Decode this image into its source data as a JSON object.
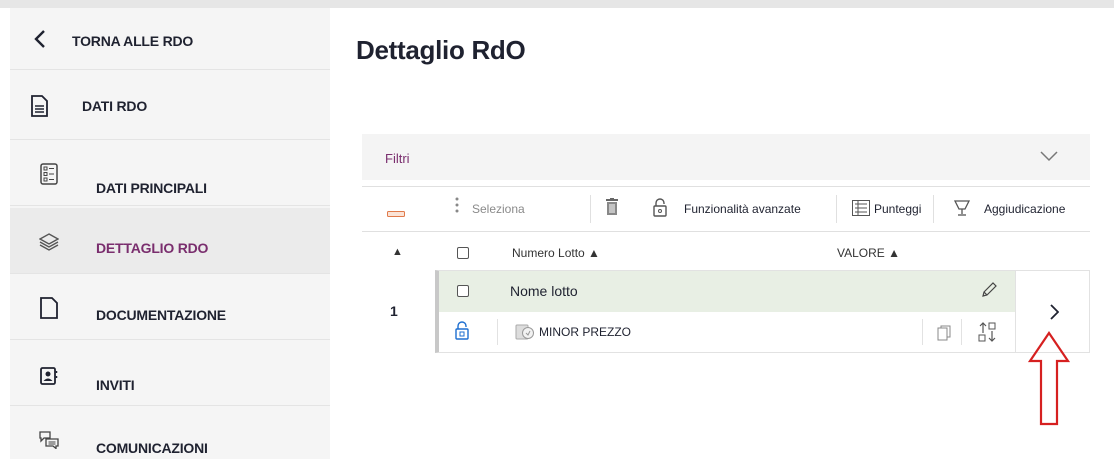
{
  "sidebar": {
    "back_label": "TORNA ALLE RDO",
    "section_label": "DATI RDO",
    "items": [
      {
        "label": "DATI PRINCIPALI",
        "icon": "list-document-icon"
      },
      {
        "label": "DETTAGLIO RDO",
        "icon": "layers-icon",
        "active": true
      },
      {
        "label": "DOCUMENTAZIONE",
        "icon": "document-icon"
      },
      {
        "label": "INVITI",
        "icon": "contact-card-icon"
      },
      {
        "label": "COMUNICAZIONI",
        "icon": "chat-icon"
      }
    ]
  },
  "main": {
    "title": "Dettaglio RdO",
    "filters_label": "Filtri",
    "toolbar": {
      "select_label": "Seleziona",
      "advanced_label": "Funzionalità avanzate",
      "scores_label": "Punteggi",
      "award_label": "Aggiudicazione"
    },
    "table": {
      "sort_indicator": "▲",
      "col_lot": "Numero Lotto ▲",
      "col_value": "VALORE ▲",
      "rows": [
        {
          "number": "1",
          "name": "Nome lotto",
          "criterion": "MINOR PREZZO"
        }
      ]
    }
  },
  "colors": {
    "accent": "#7a2e6e",
    "link_blue": "#1e6fd0",
    "row_highlight": "#e8efe4",
    "annotation_red": "#d62020"
  }
}
